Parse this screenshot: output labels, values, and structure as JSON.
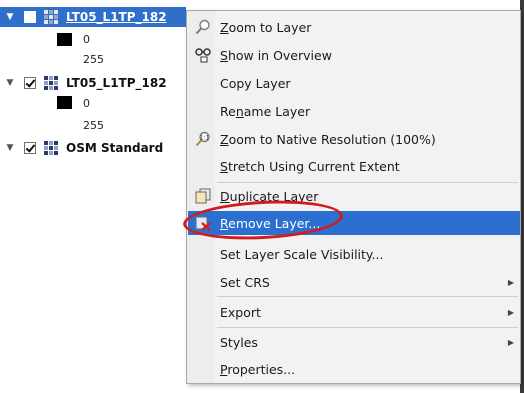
{
  "layers_panel": {
    "layers": [
      {
        "name": "LT05_L1TP_182",
        "checked": true,
        "selected": true,
        "legend": {
          "min": "0",
          "max": "255"
        }
      },
      {
        "name": "LT05_L1TP_182",
        "checked": true,
        "selected": false,
        "legend": {
          "min": "0",
          "max": "255"
        }
      },
      {
        "name": "OSM Standard",
        "checked": true,
        "selected": false
      }
    ]
  },
  "context_menu": {
    "items": [
      {
        "id": "zoom",
        "pre": "",
        "u": "Z",
        "post": "oom to Layer",
        "icon": "zoom-to-layer-icon"
      },
      {
        "id": "overview",
        "pre": "",
        "u": "S",
        "post": "how in Overview",
        "icon": "overview-icon"
      },
      {
        "id": "copy",
        "pre": "Copy Layer",
        "u": "",
        "post": "",
        "icon": ""
      },
      {
        "id": "rename",
        "pre": "Re",
        "u": "n",
        "post": "ame Layer",
        "icon": ""
      },
      {
        "id": "zoom_native",
        "pre": "",
        "u": "Z",
        "post": "oom to Native Resolution (100%)",
        "icon": "zoom-native-icon"
      },
      {
        "id": "stretch",
        "pre": "",
        "u": "S",
        "post": "tretch Using Current Extent",
        "icon": ""
      },
      {
        "id": "duplicate",
        "pre": "",
        "u": "D",
        "post": "uplicate Layer",
        "icon": "duplicate-icon"
      },
      {
        "id": "remove",
        "pre": "",
        "u": "R",
        "post": "emove Layer...",
        "icon": "remove-layer-icon"
      },
      {
        "id": "scale",
        "pre": "Set Layer Scale Visibility...",
        "u": "",
        "post": "",
        "icon": ""
      },
      {
        "id": "crs",
        "pre": "Set CRS",
        "u": "",
        "post": "",
        "icon": ""
      },
      {
        "id": "export",
        "pre": "Export",
        "u": "",
        "post": "",
        "icon": ""
      },
      {
        "id": "styles",
        "pre": "Styles",
        "u": "",
        "post": "",
        "icon": ""
      },
      {
        "id": "properties",
        "pre": "",
        "u": "P",
        "post": "roperties...",
        "icon": ""
      }
    ]
  },
  "colors": {
    "selection": "#2f6fcb",
    "menu_highlight": "#2b6fd1",
    "annotation": "#d41b1b"
  }
}
